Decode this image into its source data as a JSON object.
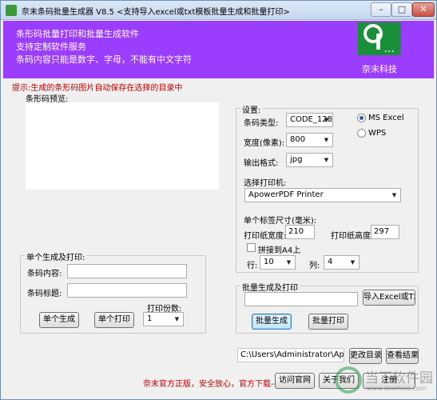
{
  "window": {
    "title": "奈末条码批量生成器 V8.5 <支持导入excel或txt模板批量生成和批量打印>",
    "minimize": "–",
    "maximize": "□",
    "close": "✕"
  },
  "banner": {
    "lines": [
      "条形码批量打印和批量生成软件",
      "支持定制软件服务",
      "条码内容只能是数字、字母，不能有中文字符"
    ],
    "brand": "奈末科技",
    "logo_text": "9...",
    "bg_color": "#9b3dfc",
    "logo_color": "#1a8f3a"
  },
  "hint": "提示:生成的条形码图片自动保存在选择的目录中",
  "preview": {
    "label": "条形码预览:"
  },
  "single": {
    "group_title": "单个生成及打印:",
    "content_label": "条码内容:",
    "content_value": "",
    "title_label": "条码标题:",
    "title_value": "",
    "copies_label": "打印份数:",
    "copies_value": "1",
    "generate_btn": "单个生成",
    "print_btn": "单个打印"
  },
  "settings": {
    "group_title": "设置:",
    "type_label": "条码类型:",
    "type_value": "CODE_128",
    "width_label": "宽度(像素):",
    "width_value": "800",
    "format_label": "输出格式:",
    "format_value": "jpg",
    "radio_excel": "MS  Excel",
    "radio_wps": "WPS",
    "excel_checked": true,
    "printer_label": "选择打印机:",
    "printer_value": "ApowerPDF Printer",
    "label_size_title": "单个标签尺寸(毫米):",
    "paper_width_label": "打印纸宽度:",
    "paper_width_value": "210",
    "paper_height_label": "打印纸高度:",
    "paper_height_value": "297",
    "tile_a4_label": "拼接到A4上",
    "row_label": "行:",
    "row_value": "10",
    "col_label": "列:",
    "col_value": "4"
  },
  "batch": {
    "group_title": "批量生成及打印",
    "file_value": "",
    "import_btn": "导入Excel或Txt",
    "generate_btn": "批量生成",
    "print_btn": "批量打印"
  },
  "output": {
    "path_value": "C:\\Users\\Administrator\\AppData\\I",
    "browse_btn": "更改目录",
    "view_btn": "查看结果"
  },
  "footer": {
    "promo": "奈末官方正版，安全放心，官方下载-->",
    "website_btn": "访问官网",
    "about_btn": "关于我们",
    "register_btn": "注册"
  },
  "watermark": {
    "text": "当下软件园",
    "url": "www.downxia.com"
  }
}
